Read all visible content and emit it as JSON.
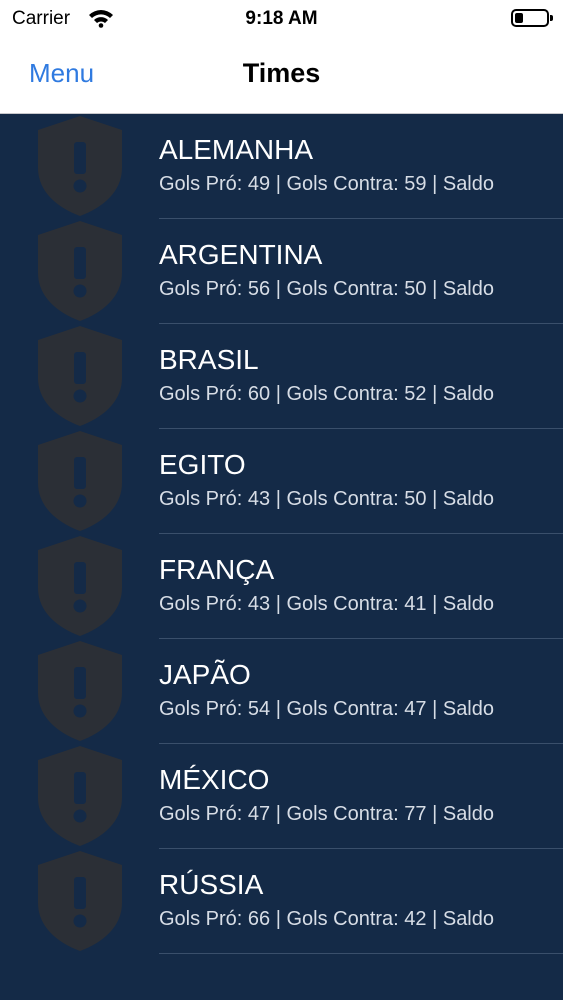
{
  "status_bar": {
    "carrier": "Carrier",
    "time": "9:18 AM",
    "icons": [
      "wifi-icon",
      "battery-icon"
    ]
  },
  "nav": {
    "menu_label": "Menu",
    "title": "Times"
  },
  "colors": {
    "background": "#142a47",
    "shield": "#2b2f36",
    "accent": "#2f7ae0"
  },
  "teams": [
    {
      "name": "ALEMANHA",
      "stats": "Gols Pró: 49 | Gols Contra: 59 | Saldo"
    },
    {
      "name": "ARGENTINA",
      "stats": "Gols Pró: 56 | Gols Contra: 50 | Saldo"
    },
    {
      "name": "BRASIL",
      "stats": "Gols Pró: 60 | Gols Contra: 52 | Saldo"
    },
    {
      "name": "EGITO",
      "stats": "Gols Pró: 43 | Gols Contra: 50 | Saldo"
    },
    {
      "name": "FRANÇA",
      "stats": "Gols Pró: 43 | Gols Contra: 41 | Saldo"
    },
    {
      "name": "JAPÃO",
      "stats": "Gols Pró: 54 | Gols Contra: 47 | Saldo"
    },
    {
      "name": "MÉXICO",
      "stats": "Gols Pró: 47 | Gols Contra: 77 | Saldo"
    },
    {
      "name": "RÚSSIA",
      "stats": "Gols Pró: 66 | Gols Contra: 42 | Saldo"
    }
  ]
}
